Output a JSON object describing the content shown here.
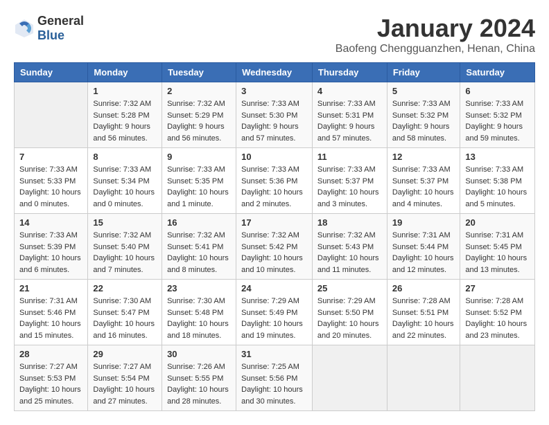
{
  "header": {
    "logo_general": "General",
    "logo_blue": "Blue",
    "month_title": "January 2024",
    "location": "Baofeng Chengguanzhen, Henan, China"
  },
  "days_of_week": [
    "Sunday",
    "Monday",
    "Tuesday",
    "Wednesday",
    "Thursday",
    "Friday",
    "Saturday"
  ],
  "weeks": [
    [
      {
        "day": "",
        "sunrise": "",
        "sunset": "",
        "daylight": ""
      },
      {
        "day": "1",
        "sunrise": "Sunrise: 7:32 AM",
        "sunset": "Sunset: 5:28 PM",
        "daylight": "Daylight: 9 hours and 56 minutes."
      },
      {
        "day": "2",
        "sunrise": "Sunrise: 7:32 AM",
        "sunset": "Sunset: 5:29 PM",
        "daylight": "Daylight: 9 hours and 56 minutes."
      },
      {
        "day": "3",
        "sunrise": "Sunrise: 7:33 AM",
        "sunset": "Sunset: 5:30 PM",
        "daylight": "Daylight: 9 hours and 57 minutes."
      },
      {
        "day": "4",
        "sunrise": "Sunrise: 7:33 AM",
        "sunset": "Sunset: 5:31 PM",
        "daylight": "Daylight: 9 hours and 57 minutes."
      },
      {
        "day": "5",
        "sunrise": "Sunrise: 7:33 AM",
        "sunset": "Sunset: 5:32 PM",
        "daylight": "Daylight: 9 hours and 58 minutes."
      },
      {
        "day": "6",
        "sunrise": "Sunrise: 7:33 AM",
        "sunset": "Sunset: 5:32 PM",
        "daylight": "Daylight: 9 hours and 59 minutes."
      }
    ],
    [
      {
        "day": "7",
        "sunrise": "Sunrise: 7:33 AM",
        "sunset": "Sunset: 5:33 PM",
        "daylight": "Daylight: 10 hours and 0 minutes."
      },
      {
        "day": "8",
        "sunrise": "Sunrise: 7:33 AM",
        "sunset": "Sunset: 5:34 PM",
        "daylight": "Daylight: 10 hours and 0 minutes."
      },
      {
        "day": "9",
        "sunrise": "Sunrise: 7:33 AM",
        "sunset": "Sunset: 5:35 PM",
        "daylight": "Daylight: 10 hours and 1 minute."
      },
      {
        "day": "10",
        "sunrise": "Sunrise: 7:33 AM",
        "sunset": "Sunset: 5:36 PM",
        "daylight": "Daylight: 10 hours and 2 minutes."
      },
      {
        "day": "11",
        "sunrise": "Sunrise: 7:33 AM",
        "sunset": "Sunset: 5:37 PM",
        "daylight": "Daylight: 10 hours and 3 minutes."
      },
      {
        "day": "12",
        "sunrise": "Sunrise: 7:33 AM",
        "sunset": "Sunset: 5:37 PM",
        "daylight": "Daylight: 10 hours and 4 minutes."
      },
      {
        "day": "13",
        "sunrise": "Sunrise: 7:33 AM",
        "sunset": "Sunset: 5:38 PM",
        "daylight": "Daylight: 10 hours and 5 minutes."
      }
    ],
    [
      {
        "day": "14",
        "sunrise": "Sunrise: 7:33 AM",
        "sunset": "Sunset: 5:39 PM",
        "daylight": "Daylight: 10 hours and 6 minutes."
      },
      {
        "day": "15",
        "sunrise": "Sunrise: 7:32 AM",
        "sunset": "Sunset: 5:40 PM",
        "daylight": "Daylight: 10 hours and 7 minutes."
      },
      {
        "day": "16",
        "sunrise": "Sunrise: 7:32 AM",
        "sunset": "Sunset: 5:41 PM",
        "daylight": "Daylight: 10 hours and 8 minutes."
      },
      {
        "day": "17",
        "sunrise": "Sunrise: 7:32 AM",
        "sunset": "Sunset: 5:42 PM",
        "daylight": "Daylight: 10 hours and 10 minutes."
      },
      {
        "day": "18",
        "sunrise": "Sunrise: 7:32 AM",
        "sunset": "Sunset: 5:43 PM",
        "daylight": "Daylight: 10 hours and 11 minutes."
      },
      {
        "day": "19",
        "sunrise": "Sunrise: 7:31 AM",
        "sunset": "Sunset: 5:44 PM",
        "daylight": "Daylight: 10 hours and 12 minutes."
      },
      {
        "day": "20",
        "sunrise": "Sunrise: 7:31 AM",
        "sunset": "Sunset: 5:45 PM",
        "daylight": "Daylight: 10 hours and 13 minutes."
      }
    ],
    [
      {
        "day": "21",
        "sunrise": "Sunrise: 7:31 AM",
        "sunset": "Sunset: 5:46 PM",
        "daylight": "Daylight: 10 hours and 15 minutes."
      },
      {
        "day": "22",
        "sunrise": "Sunrise: 7:30 AM",
        "sunset": "Sunset: 5:47 PM",
        "daylight": "Daylight: 10 hours and 16 minutes."
      },
      {
        "day": "23",
        "sunrise": "Sunrise: 7:30 AM",
        "sunset": "Sunset: 5:48 PM",
        "daylight": "Daylight: 10 hours and 18 minutes."
      },
      {
        "day": "24",
        "sunrise": "Sunrise: 7:29 AM",
        "sunset": "Sunset: 5:49 PM",
        "daylight": "Daylight: 10 hours and 19 minutes."
      },
      {
        "day": "25",
        "sunrise": "Sunrise: 7:29 AM",
        "sunset": "Sunset: 5:50 PM",
        "daylight": "Daylight: 10 hours and 20 minutes."
      },
      {
        "day": "26",
        "sunrise": "Sunrise: 7:28 AM",
        "sunset": "Sunset: 5:51 PM",
        "daylight": "Daylight: 10 hours and 22 minutes."
      },
      {
        "day": "27",
        "sunrise": "Sunrise: 7:28 AM",
        "sunset": "Sunset: 5:52 PM",
        "daylight": "Daylight: 10 hours and 23 minutes."
      }
    ],
    [
      {
        "day": "28",
        "sunrise": "Sunrise: 7:27 AM",
        "sunset": "Sunset: 5:53 PM",
        "daylight": "Daylight: 10 hours and 25 minutes."
      },
      {
        "day": "29",
        "sunrise": "Sunrise: 7:27 AM",
        "sunset": "Sunset: 5:54 PM",
        "daylight": "Daylight: 10 hours and 27 minutes."
      },
      {
        "day": "30",
        "sunrise": "Sunrise: 7:26 AM",
        "sunset": "Sunset: 5:55 PM",
        "daylight": "Daylight: 10 hours and 28 minutes."
      },
      {
        "day": "31",
        "sunrise": "Sunrise: 7:25 AM",
        "sunset": "Sunset: 5:56 PM",
        "daylight": "Daylight: 10 hours and 30 minutes."
      },
      {
        "day": "",
        "sunrise": "",
        "sunset": "",
        "daylight": ""
      },
      {
        "day": "",
        "sunrise": "",
        "sunset": "",
        "daylight": ""
      },
      {
        "day": "",
        "sunrise": "",
        "sunset": "",
        "daylight": ""
      }
    ]
  ]
}
